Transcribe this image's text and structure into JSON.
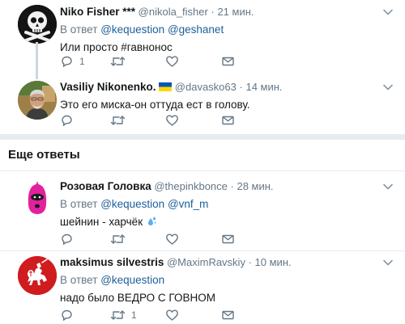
{
  "tweets": [
    {
      "name": "Niko Fisher ***",
      "handle": "@nikola_fisher",
      "time": "21 мин.",
      "reply_prefix": "В ответ",
      "reply_to": "@kequestion @geshanet",
      "text": "Или просто #гавнонос",
      "reply_count": "1",
      "retweet_count": "",
      "like_count": ""
    },
    {
      "name": "Vasiliy Nikonenko.",
      "flag": "Ukraine flag",
      "handle": "@davasko63",
      "time": "14 мин.",
      "text": "Это его миска-он оттуда ест в голову.",
      "reply_count": "",
      "retweet_count": "",
      "like_count": ""
    }
  ],
  "more_replies": {
    "title": "Еще ответы",
    "tweets": [
      {
        "name": "Розовая Головка",
        "handle": "@thepinkbonce",
        "time": "28 мин.",
        "reply_prefix": "В ответ",
        "reply_to": "@kequestion @vnf_m",
        "text": "шейнин - харчёк",
        "emoji": "splash-emoji",
        "reply_count": "",
        "retweet_count": "",
        "like_count": ""
      },
      {
        "name": "maksimus silvestris",
        "handle": "@MaximRavskiy",
        "time": "10 мин.",
        "reply_prefix": "В ответ",
        "reply_to": "@kequestion",
        "text": "надо было ВЕДРО С ГОВНОМ",
        "reply_count": "",
        "retweet_count": "1",
        "like_count": ""
      }
    ]
  },
  "separator": "·",
  "colors": {
    "text": "#14171a",
    "muted": "#657786",
    "link": "#1d5f9a",
    "divider": "#e6ecf0",
    "pink_avatar": "#e3219f",
    "pahonia_red": "#d01c1f",
    "flag_blue": "#0057b7",
    "flag_yellow": "#ffd700"
  },
  "icons": [
    "reply-icon",
    "retweet-icon",
    "like-icon",
    "mail-icon",
    "chevron-down-icon"
  ]
}
